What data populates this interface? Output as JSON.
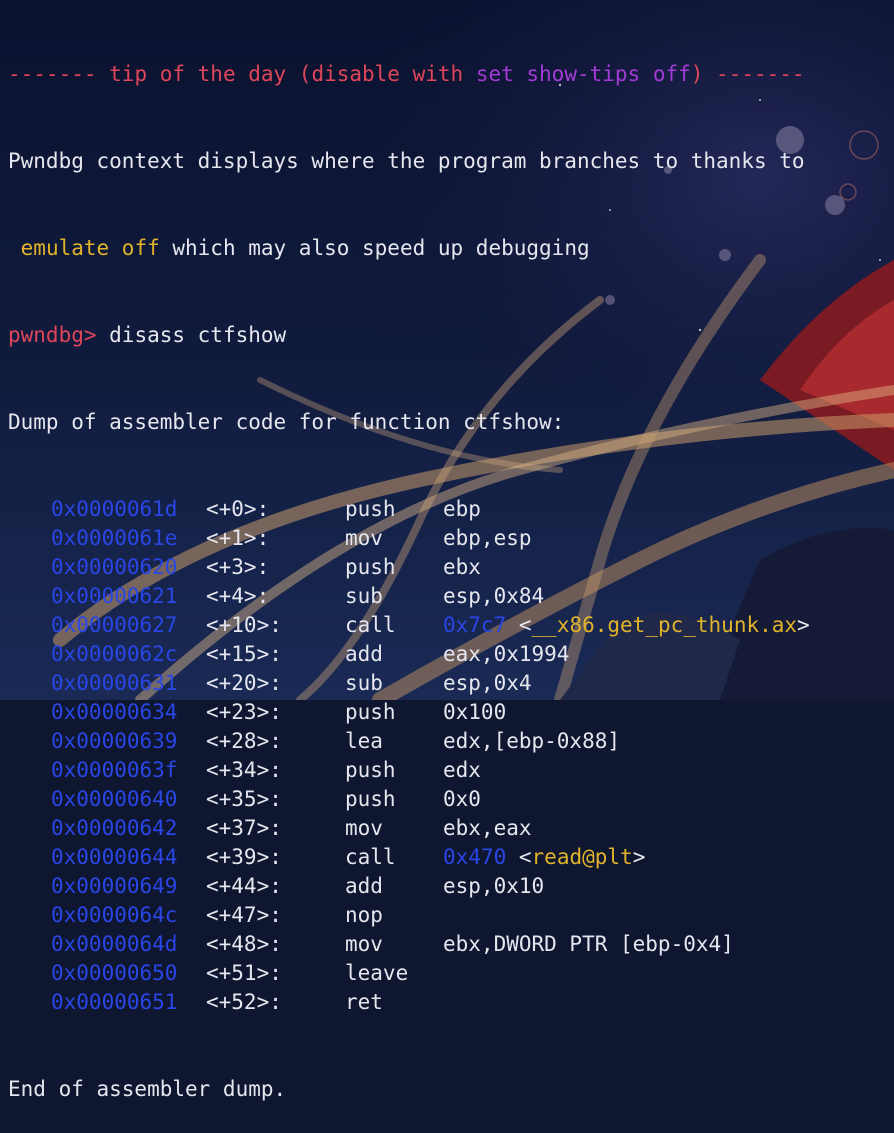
{
  "tip": {
    "dashes_left": "-------",
    "text_before": " tip of the day (disable with ",
    "command": "set show-tips off",
    "text_after": ") ",
    "dashes_right": "-------"
  },
  "tip_body": {
    "line1": "Pwndbg context displays where the program branches to thanks to",
    "line2_highlight": "emulate off",
    "line2_rest": " which may also speed up debugging"
  },
  "prompt": "pwndbg>",
  "command": " disass ctfshow",
  "dump_header": "Dump of assembler code for function ctfshow:",
  "instructions": [
    {
      "address": "0x0000061d",
      "offset": "<+0>:",
      "mnemonic": "push",
      "operands": "ebp"
    },
    {
      "address": "0x0000061e",
      "offset": "<+1>:",
      "mnemonic": "mov",
      "operands": "ebp,esp"
    },
    {
      "address": "0x00000620",
      "offset": "<+3>:",
      "mnemonic": "push",
      "operands": "ebx"
    },
    {
      "address": "0x00000621",
      "offset": "<+4>:",
      "mnemonic": "sub",
      "operands": "esp,0x84"
    },
    {
      "address": "0x00000627",
      "offset": "<+10>:",
      "mnemonic": "call",
      "target": "0x7c7",
      "sym_open": "<",
      "symbol": "__x86.get_pc_thunk.ax",
      "sym_close": ">"
    },
    {
      "address": "0x0000062c",
      "offset": "<+15>:",
      "mnemonic": "add",
      "operands": "eax,0x1994"
    },
    {
      "address": "0x00000631",
      "offset": "<+20>:",
      "mnemonic": "sub",
      "operands": "esp,0x4"
    },
    {
      "address": "0x00000634",
      "offset": "<+23>:",
      "mnemonic": "push",
      "operands": "0x100"
    },
    {
      "address": "0x00000639",
      "offset": "<+28>:",
      "mnemonic": "lea",
      "operands": "edx,[ebp-0x88]"
    },
    {
      "address": "0x0000063f",
      "offset": "<+34>:",
      "mnemonic": "push",
      "operands": "edx"
    },
    {
      "address": "0x00000640",
      "offset": "<+35>:",
      "mnemonic": "push",
      "operands": "0x0"
    },
    {
      "address": "0x00000642",
      "offset": "<+37>:",
      "mnemonic": "mov",
      "operands": "ebx,eax"
    },
    {
      "address": "0x00000644",
      "offset": "<+39>:",
      "mnemonic": "call",
      "target": "0x470",
      "sym_open": "<",
      "symbol": "read@plt",
      "sym_close": ">"
    },
    {
      "address": "0x00000649",
      "offset": "<+44>:",
      "mnemonic": "add",
      "operands": "esp,0x10"
    },
    {
      "address": "0x0000064c",
      "offset": "<+47>:",
      "mnemonic": "nop",
      "operands": ""
    },
    {
      "address": "0x0000064d",
      "offset": "<+48>:",
      "mnemonic": "mov",
      "operands": "ebx,DWORD PTR [ebp-0x4]"
    },
    {
      "address": "0x00000650",
      "offset": "<+51>:",
      "mnemonic": "leave",
      "operands": ""
    },
    {
      "address": "0x00000651",
      "offset": "<+52>:",
      "mnemonic": "ret",
      "operands": ""
    }
  ],
  "dump_footer": "End of assembler dump.",
  "colors": {
    "background": "#0e1630",
    "text": "#e6e6ee",
    "address": "#2a46e6",
    "prompt": "#e0465a",
    "highlight": "#e0b32a",
    "tip_command": "#a23bd6"
  }
}
